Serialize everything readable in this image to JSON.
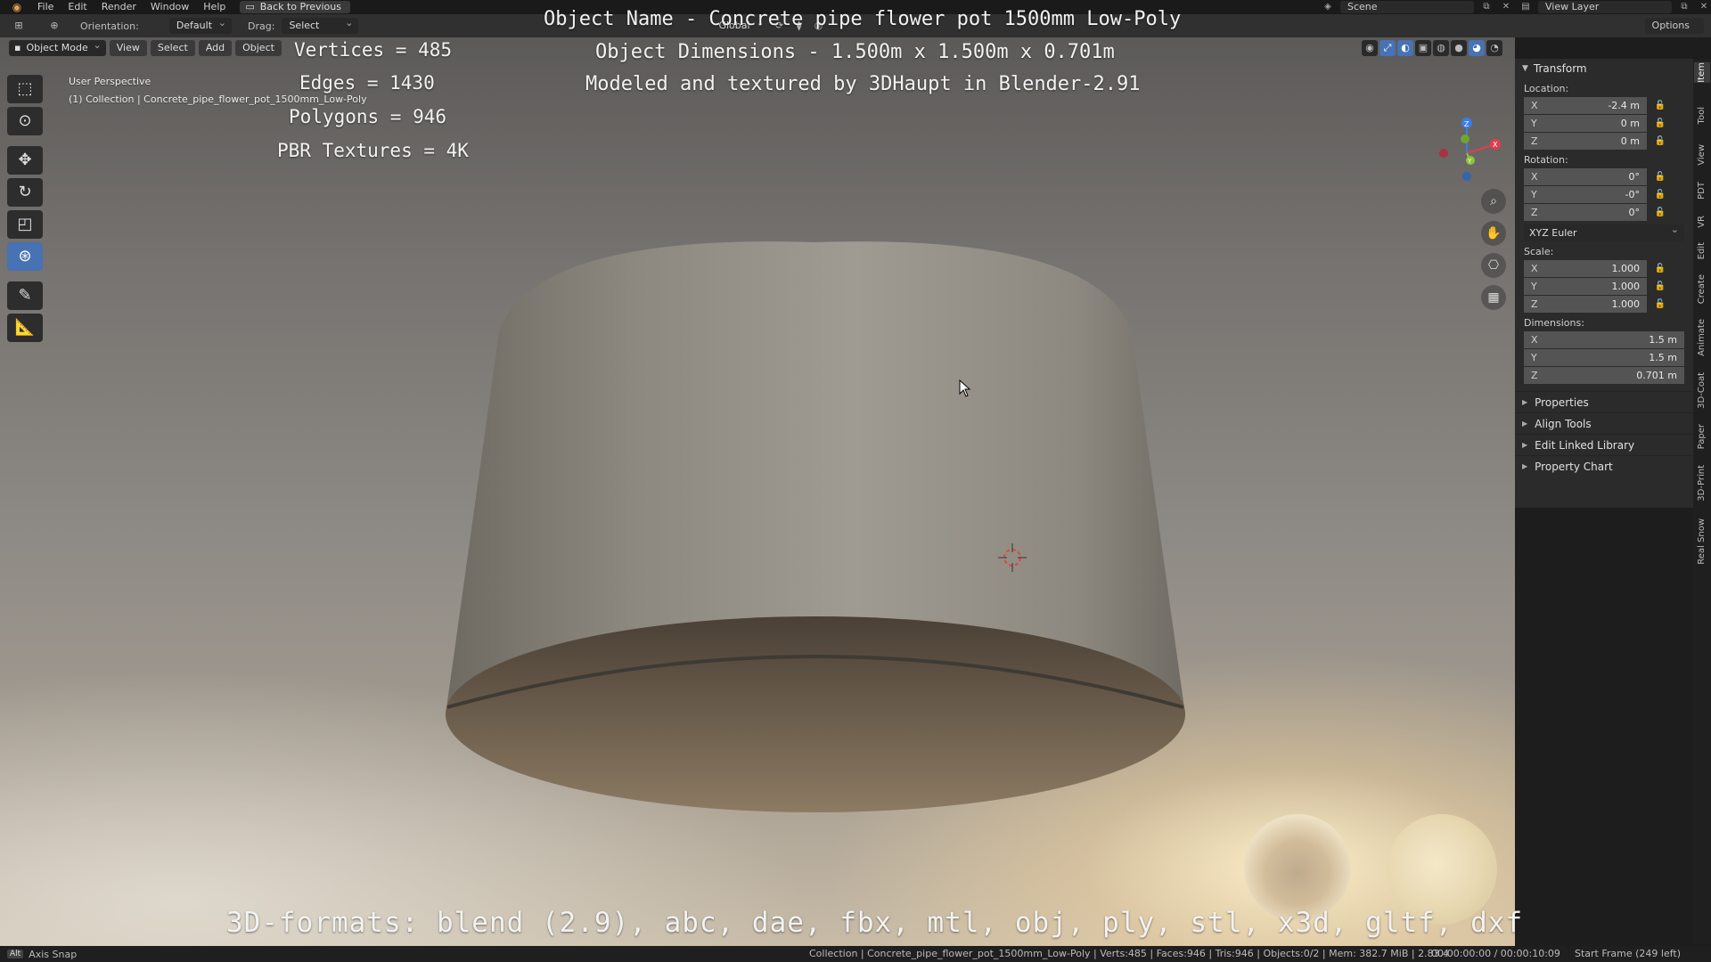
{
  "topbar": {
    "menu": [
      "File",
      "Edit",
      "Render",
      "Window",
      "Help"
    ],
    "back_label": "Back to Previous",
    "scene": "Scene",
    "view_layer": "View Layer"
  },
  "header": {
    "orientation_label": "Orientation:",
    "orientation_value": "Default",
    "drag_label": "Drag:",
    "drag_value": "Select Box",
    "transform_orientation": "Global",
    "options_label": "Options"
  },
  "viewport_header": {
    "mode": "Object Mode",
    "menus": [
      "View",
      "Select",
      "Add",
      "Object"
    ]
  },
  "viewport": {
    "perspective": "User Perspective",
    "collection": "(1) Collection | Concrete_pipe_flower_pot_1500mm_Low-Poly"
  },
  "overlay": {
    "vertices": "Vertices = 485",
    "edges": "Edges = 1430",
    "polygons": "Polygons = 946",
    "textures": "PBR Textures = 4K",
    "object_name": "Object Name - Concrete pipe flower pot 1500mm Low-Poly",
    "object_dims": "Object Dimensions -  1.500m x 1.500m x 0.701m",
    "modeled_by": "Modeled and textured by 3DHaupt in Blender-2.91",
    "formats": "3D-formats: blend (2.9), abc, dae, fbx, mtl, obj, ply, stl, x3d, gltf, dxf"
  },
  "gizmo": {
    "x_label": "X",
    "y_label": "Y",
    "z_label": "Z",
    "colors": {
      "x": "#e23c4b",
      "y": "#8bc43c",
      "z": "#3c7ee2"
    }
  },
  "npanel": {
    "transform_title": "Transform",
    "location_label": "Location:",
    "location": {
      "x": "-2.4 m",
      "y": "0 m",
      "z": "0 m"
    },
    "rotation_label": "Rotation:",
    "rotation": {
      "x": "0°",
      "y": "-0°",
      "z": "0°"
    },
    "rotation_mode": "XYZ Euler",
    "scale_label": "Scale:",
    "scale": {
      "x": "1.000",
      "y": "1.000",
      "z": "1.000"
    },
    "dimensions_label": "Dimensions:",
    "dimensions": {
      "x": "1.5 m",
      "y": "1.5 m",
      "z": "0.701 m"
    },
    "collapsed_sections": [
      "Properties",
      "Align Tools",
      "Edit Linked Library",
      "Property Chart"
    ],
    "axis_labels": {
      "x": "X",
      "y": "Y",
      "z": "Z"
    }
  },
  "vtabs": [
    "Item",
    "Tool",
    "View",
    "PDT",
    "VR",
    "Edit",
    "Create",
    "Animate",
    "3D-Coat",
    "Paper",
    "3D-Print",
    "Real Snow"
  ],
  "statusbar": {
    "key": "Alt",
    "axis_snap": "Axis Snap",
    "stats": "Collection | Concrete_pipe_flower_pot_1500mm_Low-Poly | Verts:485 | Faces:946 | Tris:946 | Objects:0/2 | Mem: 382.7 MiB | 2.83.4",
    "time": "00:00:00:00 / 00:00:10:09",
    "frame": "Start Frame (249 left)"
  },
  "colors": {
    "accent": "#4772b3",
    "panel": "#2b2b2b",
    "field": "#545454"
  }
}
